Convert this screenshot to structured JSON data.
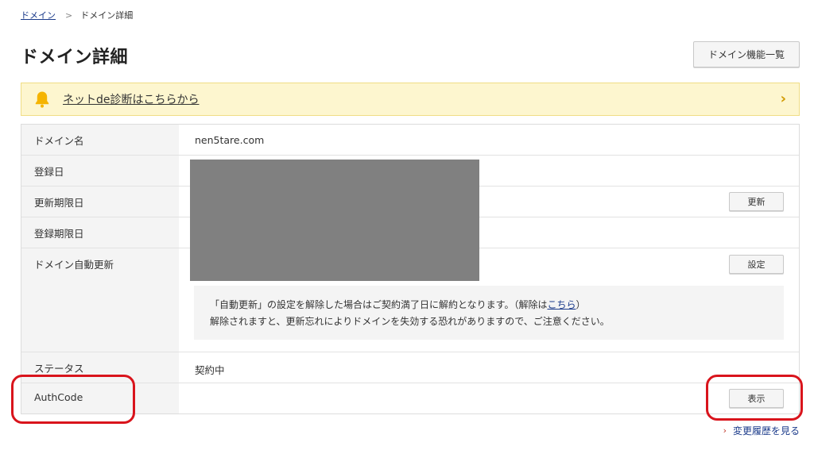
{
  "breadcrumb": {
    "parent": "ドメイン",
    "current": "ドメイン詳細"
  },
  "page": {
    "title": "ドメイン詳細",
    "list_button": "ドメイン機能一覧"
  },
  "banner": {
    "text": "ネットde診断はこちらから",
    "icon": "bell-icon",
    "arrow_icon": "chevron-right-icon"
  },
  "details": {
    "domain_name_label": "ドメイン名",
    "domain_name_value": "nen5tare.com",
    "registered_label": "登録日",
    "renewal_deadline_label": "更新期限日",
    "renew_button": "更新",
    "registration_deadline_label": "登録期限日",
    "auto_renew_label": "ドメイン自動更新",
    "settings_button": "設定",
    "notice_line1_prefix": "「自動更新」の設定を解除した場合はご契約満了日に解約となります。（解除は",
    "notice_line1_link": "こちら",
    "notice_line1_suffix": "）",
    "notice_line2": "解除されますと、更新忘れによりドメインを失効する恐れがありますので、ご注意ください。",
    "status_label": "ステータス",
    "status_value": "契約中",
    "authcode_label": "AuthCode",
    "show_button": "表示"
  },
  "footer": {
    "history_link": "変更履歴を見る"
  },
  "colors": {
    "banner_bg": "#fdf6cf",
    "highlight": "#d9141c",
    "link": "#1a3a8a",
    "bell": "#f5b400"
  }
}
